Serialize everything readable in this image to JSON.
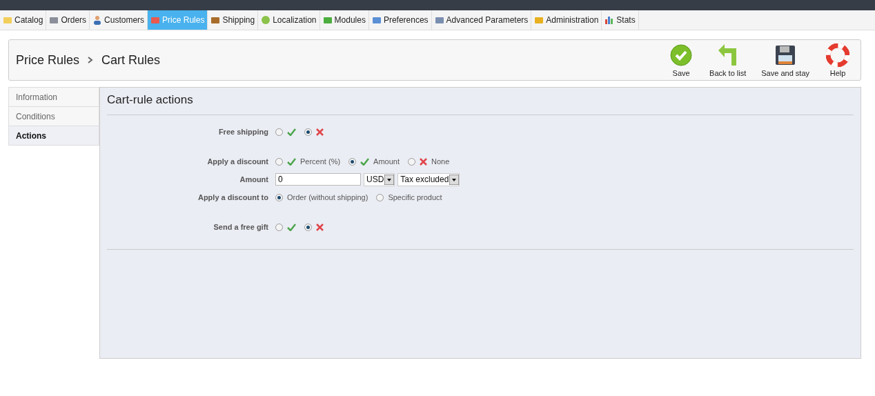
{
  "menu_tabs": [
    {
      "label": "Catalog",
      "selected": false
    },
    {
      "label": "Orders",
      "selected": false
    },
    {
      "label": "Customers",
      "selected": false
    },
    {
      "label": "Price Rules",
      "selected": true
    },
    {
      "label": "Shipping",
      "selected": false
    },
    {
      "label": "Localization",
      "selected": false
    },
    {
      "label": "Modules",
      "selected": false
    },
    {
      "label": "Preferences",
      "selected": false
    },
    {
      "label": "Advanced Parameters",
      "selected": false
    },
    {
      "label": "Administration",
      "selected": false
    },
    {
      "label": "Stats",
      "selected": false
    }
  ],
  "breadcrumb": [
    "Price Rules",
    "Cart Rules"
  ],
  "toolbar": [
    {
      "label": "Save",
      "kind": "save"
    },
    {
      "label": "Back to list",
      "kind": "back"
    },
    {
      "label": "Save and stay",
      "kind": "disk"
    },
    {
      "label": "Help",
      "kind": "help"
    }
  ],
  "side_tabs": [
    {
      "label": "Information",
      "selected": false
    },
    {
      "label": "Conditions",
      "selected": false
    },
    {
      "label": "Actions",
      "selected": true
    }
  ],
  "section_title": "Cart-rule actions",
  "field_groups": [
    {
      "fields": [
        {
          "kind": "radio",
          "label": "Free shipping",
          "options": [
            {
              "kind": "yes",
              "selected": false
            },
            {
              "kind": "no",
              "selected": true
            }
          ]
        }
      ]
    },
    {
      "fields": [
        {
          "kind": "radio",
          "label": "Apply a discount",
          "options": [
            {
              "kind": "yes",
              "text": "Percent (%)",
              "selected": false
            },
            {
              "kind": "yes",
              "text": "Amount",
              "selected": true
            },
            {
              "kind": "no",
              "text": "None",
              "selected": false
            }
          ]
        },
        {
          "kind": "amount",
          "label": "Amount",
          "value": "0",
          "currency": "USD",
          "tax": "Tax excluded"
        },
        {
          "kind": "radio",
          "label": "Apply a discount to",
          "options": [
            {
              "text": "Order (without shipping)",
              "selected": true
            },
            {
              "text": "Specific product",
              "selected": false
            }
          ]
        }
      ]
    },
    {
      "fields": [
        {
          "kind": "radio",
          "label": "Send a free gift",
          "options": [
            {
              "kind": "yes",
              "selected": false
            },
            {
              "kind": "no",
              "selected": true
            }
          ]
        }
      ]
    }
  ]
}
